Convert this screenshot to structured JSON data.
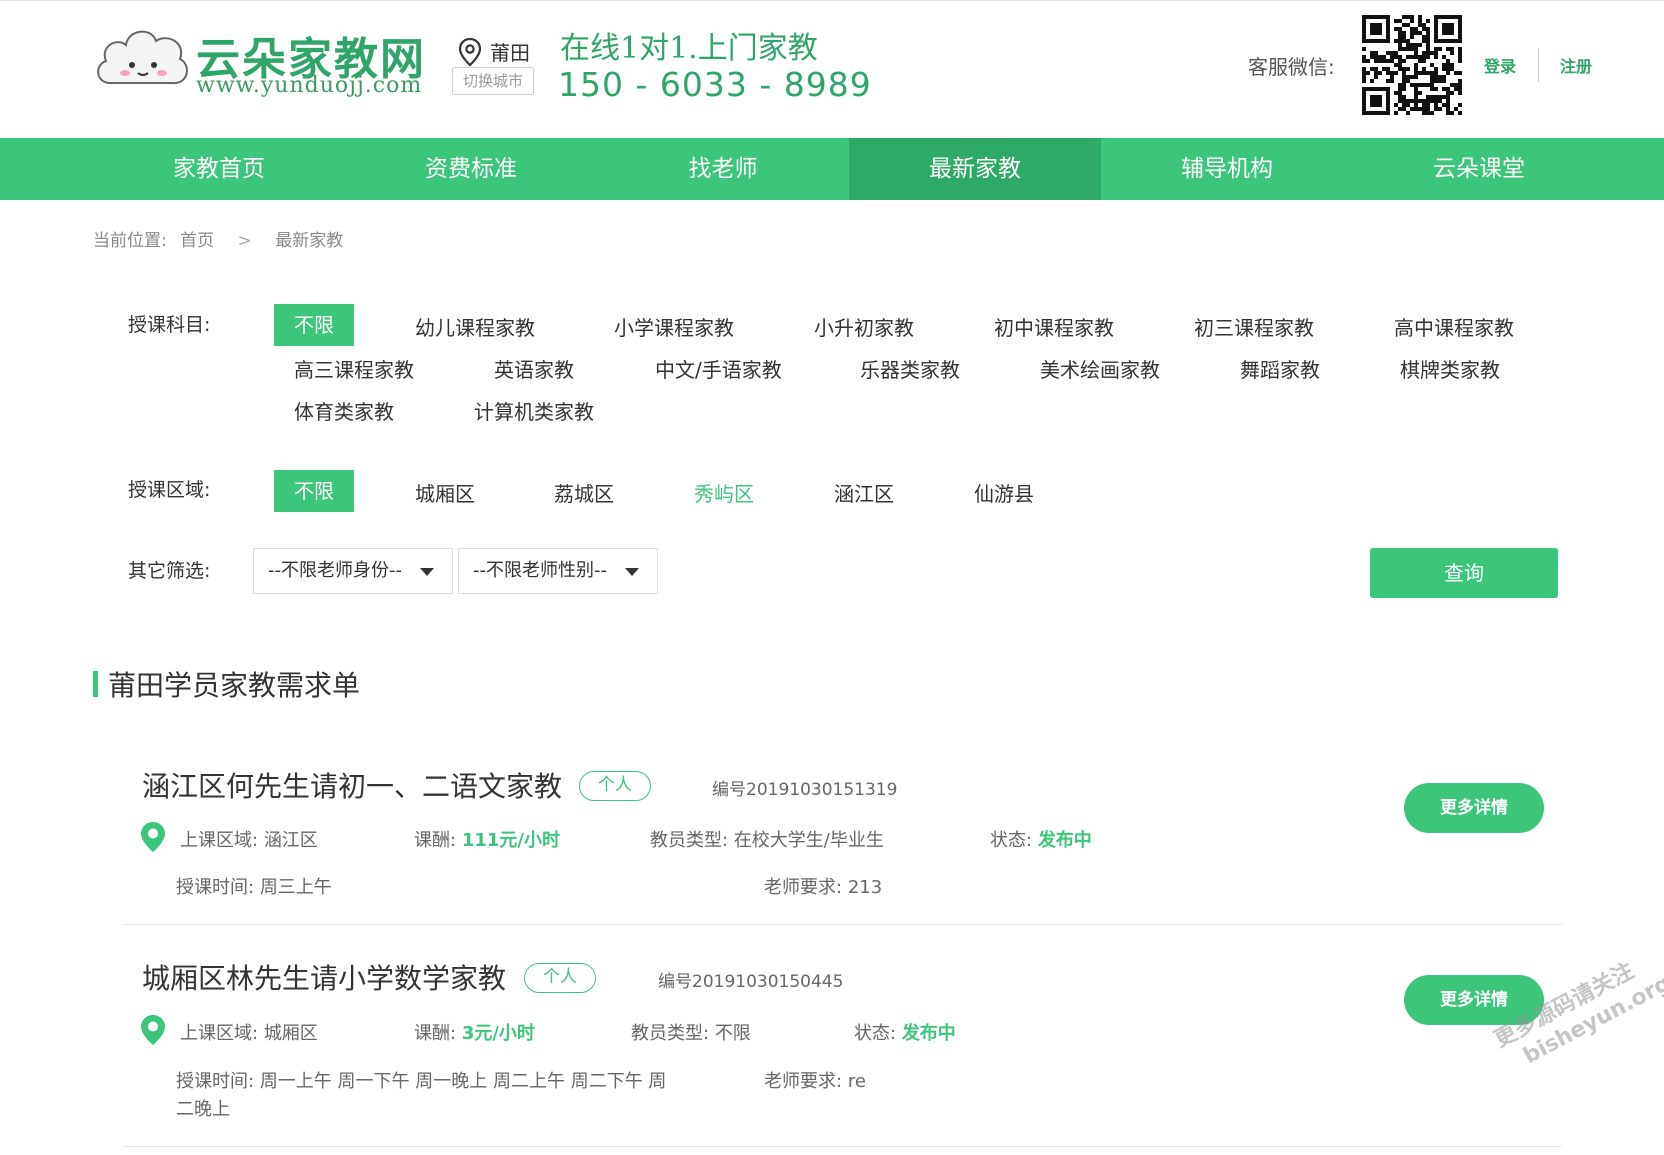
{
  "header": {
    "logo": {
      "name": "云朵家教网",
      "url": "www.yunduojj.com"
    },
    "city": {
      "name": "莆田",
      "switch_label": "切换城市"
    },
    "slogan": "在线1对1.上门家教",
    "hotline": "150 - 6033 - 8989",
    "kefu_label": "客服微信:",
    "login_label": "登录",
    "register_label": "注册"
  },
  "nav": {
    "items": [
      {
        "label": "家教首页",
        "active": false
      },
      {
        "label": "资费标准",
        "active": false
      },
      {
        "label": "找老师",
        "active": false
      },
      {
        "label": "最新家教",
        "active": true
      },
      {
        "label": "辅导机构",
        "active": false
      },
      {
        "label": "云朵课堂",
        "active": false
      }
    ]
  },
  "breadcrumb": {
    "prefix": "当前位置:",
    "home": "首页",
    "sep": ">",
    "current": "最新家教"
  },
  "filters": {
    "subject": {
      "label": "授课科目:",
      "options": [
        "不限",
        "幼儿课程家教",
        "小学课程家教",
        "小升初家教",
        "初中课程家教",
        "初三课程家教",
        "高中课程家教",
        "高三课程家教",
        "英语家教",
        "中文/手语家教",
        "乐器类家教",
        "美术绘画家教",
        "舞蹈家教",
        "棋牌类家教",
        "体育类家教",
        "计算机类家教"
      ],
      "selected": "不限"
    },
    "area": {
      "label": "授课区域:",
      "options": [
        "不限",
        "城厢区",
        "荔城区",
        "秀屿区",
        "涵江区",
        "仙游县"
      ],
      "selected": "不限",
      "highlighted": "秀屿区"
    },
    "other": {
      "label": "其它筛选:",
      "identity_select": "--不限老师身份--",
      "gender_select": "--不限老师性别--"
    },
    "query_button": "查询"
  },
  "section_title": "莆田学员家教需求单",
  "orders": [
    {
      "title": "涵江区何先生请初一、二语文家教",
      "tag": "个人",
      "number": "编号20191030151319",
      "area_label": "上课区域:",
      "area": "涵江区",
      "pay_label": "课酬:",
      "pay": "111元/小时",
      "type_label": "教员类型:",
      "type": "在校大学生/毕业生",
      "status_label": "状态:",
      "status": "发布中",
      "time_label": "授课时间:",
      "time": "周三上午",
      "req_label": "老师要求:",
      "requirement": "213",
      "more_button": "更多详情"
    },
    {
      "title": "城厢区林先生请小学数学家教",
      "tag": "个人",
      "number": "编号20191030150445",
      "area_label": "上课区域:",
      "area": "城厢区",
      "pay_label": "课酬:",
      "pay": "3元/小时",
      "type_label": "教员类型:",
      "type": "不限",
      "status_label": "状态:",
      "status": "发布中",
      "time_label": "授课时间:",
      "time": "周一上午 周一下午 周一晚上 周二上午 周二下午 周",
      "time_cont": "二晚上",
      "req_label": "老师要求:",
      "requirement": "re",
      "more_button": "更多详情"
    }
  ],
  "watermark": {
    "line1": "更多源码请关注",
    "line2": "bisheyun.org"
  },
  "colors": {
    "brand": "#3dc57c",
    "brand_dark": "#2fa967",
    "text": "#333333",
    "muted": "#888888"
  },
  "icons": [
    "location-pin-icon",
    "cloud-mascot-logo",
    "qrcode-image",
    "dropdown-caret-icon",
    "map-marker-icon"
  ]
}
